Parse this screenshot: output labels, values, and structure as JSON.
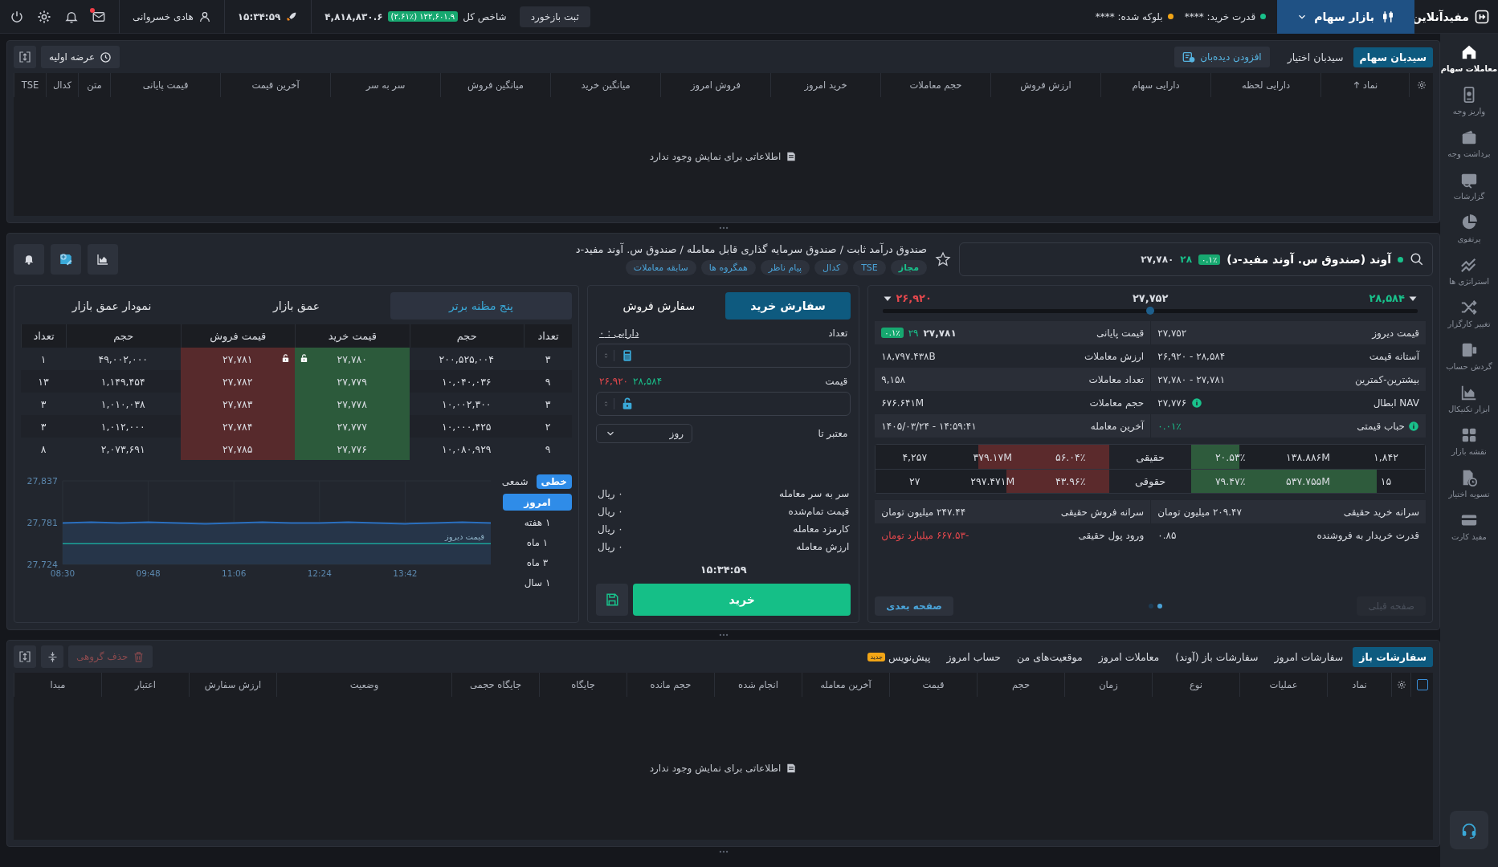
{
  "topbar": {
    "brand": "مفیدآنلاین",
    "market": "بازار سهام",
    "buying_power": "قدرت خرید: ****",
    "blocked": "بلوکه شده: ****",
    "feedback": "ثبت بازخورد",
    "index_label": "شاخص کل",
    "index_change": "(۲.۶۱٪) ۱۲۲,۶۰۱.۹",
    "index_value": "۴,۸۱۸,۸۳۰.۶",
    "time": "۱۵:۳۴:۵۹",
    "user": "هادی خسروانی",
    "mail_unread": true
  },
  "sidebar": {
    "items": [
      {
        "label": "معاملات سهام",
        "selected": true
      },
      {
        "label": "واریز وجه",
        "selected": false
      },
      {
        "label": "برداشت وجه",
        "selected": false
      },
      {
        "label": "گزارشات",
        "selected": false
      },
      {
        "label": "پرتفوی",
        "selected": false
      },
      {
        "label": "استراتژی ها",
        "selected": false
      },
      {
        "label": "تغییر کارگزار",
        "selected": false
      },
      {
        "label": "گردش حساب",
        "selected": false
      },
      {
        "label": "ابزار تکنیکال",
        "selected": false
      },
      {
        "label": "نقشه بازار",
        "selected": false
      },
      {
        "label": "تسویه اختیار",
        "selected": false
      },
      {
        "label": "مفید کارت",
        "selected": false
      }
    ]
  },
  "watchlist": {
    "tabs": [
      {
        "label": "سیدبان سهام",
        "selected": true
      },
      {
        "label": "سیدبان اختیار",
        "selected": false
      }
    ],
    "add_button": "افزودن دیده‌بان",
    "ipo_button": "عرضه اولیه",
    "columns": [
      {
        "label": "نماد",
        "sorted": true
      },
      {
        "label": "دارایی لحظه",
        "sorted": false
      },
      {
        "label": "دارایی سهام",
        "sorted": false
      },
      {
        "label": "ارزش فروش",
        "sorted": false
      },
      {
        "label": "حجم معاملات",
        "sorted": false
      },
      {
        "label": "خرید امروز",
        "sorted": false
      },
      {
        "label": "فروش امروز",
        "sorted": false
      },
      {
        "label": "میانگین خرید",
        "sorted": false
      },
      {
        "label": "میانگین فروش",
        "sorted": false
      },
      {
        "label": "سر به سر",
        "sorted": false
      },
      {
        "label": "آخرین قیمت",
        "sorted": false
      },
      {
        "label": "قیمت پایانی",
        "sorted": false
      },
      {
        "label": "متن",
        "sorted": false
      },
      {
        "label": "کدال",
        "sorted": false
      },
      {
        "label": "TSE",
        "sorted": false
      }
    ],
    "empty_message": "اطلاعاتی برای نمایش وجود ندارد"
  },
  "symbol": {
    "name": "آوند (صندوق س. آوند مفید-د)",
    "change_percent": "۰.۱٪",
    "change": "۲۸",
    "last_price": "۲۷,۷۸۰",
    "breadcrumb": "صندوق درآمد ثابت / صندوق سرمایه گذاری قابل معامله / صندوق س. آوند مفید-د",
    "tags": [
      {
        "label": "مجاز",
        "kind": "status"
      },
      {
        "label": "TSE",
        "kind": "link"
      },
      {
        "label": "کدال",
        "kind": "link"
      },
      {
        "label": "پیام ناظر",
        "kind": "link"
      },
      {
        "label": "همگروه ها",
        "kind": "link"
      },
      {
        "label": "سابقه معاملات",
        "kind": "link"
      }
    ]
  },
  "price_range": {
    "high": "۲۸,۵۸۴",
    "reference": "۲۷,۷۵۲",
    "low": "۲۶,۹۲۰",
    "level": 0.5
  },
  "stats": [
    {
      "kind": "plain",
      "label": "قیمت دیروز",
      "value": "۲۷,۷۵۲"
    },
    {
      "kind": "price",
      "label": "قیمت پایانی",
      "value": "۲۷,۷۸۱",
      "change": "۲۹",
      "change_percent": "۰.۱٪"
    },
    {
      "kind": "plain",
      "label": "آستانه قیمت",
      "value": "۲۶,۹۲۰ - ۲۸,۵۸۴"
    },
    {
      "kind": "plain",
      "label": "ارزش معاملات",
      "value": "۱۸,۷۹۷.۴۳۸B"
    },
    {
      "kind": "plain",
      "label": "بیشترین-کمترین",
      "value": "۲۷,۷۸۰ - ۲۷,۷۸۱"
    },
    {
      "kind": "plain",
      "label": "تعداد معاملات",
      "value": "۹,۱۵۸"
    },
    {
      "kind": "info_value",
      "label": "NAV ابطال",
      "value": "۲۷,۷۷۶"
    },
    {
      "kind": "plain",
      "label": "حجم معاملات",
      "value": "۶۷۶.۶۴۱M"
    },
    {
      "kind": "info_label",
      "label": "حباب قیمتی",
      "value": "۰.۰۱٪"
    },
    {
      "kind": "plain",
      "label": "آخرین معامله",
      "value": "۱۴۰۵/۰۳/۲۴ - ۱۴:۵۹:۴۱"
    }
  ],
  "traders": [
    {
      "label": "حقیقی",
      "buy": {
        "count": "۱,۸۴۲",
        "volume": "۱۳۸.۸۸۶M",
        "percent": "۲۰.۵۳٪",
        "level": 0.2053
      },
      "sell": {
        "count": "۴,۲۵۷",
        "volume": "۳۷۹.۱۷M",
        "percent": "۵۶.۰۴٪",
        "level": 0.5604
      }
    },
    {
      "label": "حقوقی",
      "buy": {
        "count": "۱۵",
        "volume": "۵۳۷.۷۵۵M",
        "percent": "۷۹.۴۷٪",
        "level": 0.7947
      },
      "sell": {
        "count": "۲۷",
        "volume": "۲۹۷.۴۷۱M",
        "percent": "۴۳.۹۶٪",
        "level": 0.4396
      }
    }
  ],
  "per_capita": [
    {
      "label": "سرانه خرید حقیقی",
      "value": "۲۰۹.۴۷ میلیون تومان",
      "negative": false
    },
    {
      "label": "سرانه فروش حقیقی",
      "value": "۲۴۷.۴۴ میلیون تومان",
      "negative": false
    },
    {
      "label": "قدرت خریدار به فروشنده",
      "value": "۰.۸۵",
      "negative": false
    },
    {
      "label": "ورود پول حقیقی",
      "value": "-۶۶۷.۵۳ میلیارد تومان",
      "negative": true
    }
  ],
  "pager": {
    "previous": {
      "label": "صفحه قبلی",
      "disabled": true
    },
    "next": {
      "label": "صفحه بعدی",
      "disabled": false
    },
    "pages": [
      {
        "selected": true
      },
      {
        "selected": false
      }
    ]
  },
  "order_form": {
    "tabs": [
      {
        "label": "سفارش خرید",
        "selected": true
      },
      {
        "label": "سفارش فروش",
        "selected": false
      }
    ],
    "quantity_label": "تعداد",
    "holding": "دارایی : ۰",
    "price_label": "قیمت",
    "price_high": "۲۸,۵۸۴",
    "price_low": "۲۶,۹۲۰",
    "validity_label": "معتبر تا",
    "validity": "روز",
    "summary": [
      {
        "label": "سر به سر معامله",
        "value": "۰ ریال"
      },
      {
        "label": "قیمت تمام‌شده",
        "value": "۰ ریال"
      },
      {
        "label": "کارمزد معامله",
        "value": "۰ ریال"
      },
      {
        "label": "ارزش معامله",
        "value": "۰ ریال"
      }
    ],
    "time": "۱۵:۳۴:۵۹",
    "submit": "خرید"
  },
  "order_book": {
    "tabs": [
      {
        "label": "پنج مظنه برتر",
        "selected": true
      },
      {
        "label": "عمق بازار",
        "selected": false
      },
      {
        "label": "نمودار عمق بازار",
        "selected": false
      }
    ],
    "columns": [
      "تعداد",
      "حجم",
      "قیمت خرید",
      "قیمت فروش",
      "حجم",
      "تعداد"
    ],
    "rows": [
      {
        "buy_count": "۳",
        "buy_volume": "۲۰۰,۵۲۵,۰۰۴",
        "buy_price": "۲۷,۷۸۰",
        "sell_price": "۲۷,۷۸۱",
        "sell_volume": "۴۹,۰۰۲,۰۰۰",
        "sell_count": "۱",
        "locked": true
      },
      {
        "buy_count": "۹",
        "buy_volume": "۱۰,۰۴۰,۰۳۶",
        "buy_price": "۲۷,۷۷۹",
        "sell_price": "۲۷,۷۸۲",
        "sell_volume": "۱,۱۴۹,۴۵۴",
        "sell_count": "۱۳",
        "locked": false
      },
      {
        "buy_count": "۳",
        "buy_volume": "۱۰,۰۰۲,۳۰۰",
        "buy_price": "۲۷,۷۷۸",
        "sell_price": "۲۷,۷۸۳",
        "sell_volume": "۱,۰۱۰,۰۳۸",
        "sell_count": "۳",
        "locked": false
      },
      {
        "buy_count": "۲",
        "buy_volume": "۱۰,۰۰۰,۴۲۵",
        "buy_price": "۲۷,۷۷۷",
        "sell_price": "۲۷,۷۸۴",
        "sell_volume": "۱,۰۱۲,۰۰۰",
        "sell_count": "۳",
        "locked": false
      },
      {
        "buy_count": "۹",
        "buy_volume": "۱۰,۰۸۰,۹۲۹",
        "buy_price": "۲۷,۷۷۶",
        "sell_price": "۲۷,۷۸۵",
        "sell_volume": "۲,۰۷۳,۶۹۱",
        "sell_count": "۸",
        "locked": false
      }
    ]
  },
  "price_chart": {
    "chart_types": [
      {
        "label": "خطی",
        "selected": true
      },
      {
        "label": "شمعی",
        "selected": false
      }
    ],
    "periods": [
      {
        "label": "امروز",
        "selected": true
      },
      {
        "label": "۱ هفته",
        "selected": false
      },
      {
        "label": "۱ ماه",
        "selected": false
      },
      {
        "label": "۳ ماه",
        "selected": false
      },
      {
        "label": "۱ سال",
        "selected": false
      }
    ],
    "chart_data": {
      "type": "area",
      "categories": [
        "08:30",
        null,
        null,
        "09:48",
        null,
        null,
        "11:06",
        null,
        null,
        "12:24",
        null,
        null,
        "13:42",
        null,
        null,
        null
      ],
      "series": [
        {
          "color": "#2a6fbf",
          "values": [
            27780,
            27781,
            27780,
            27781,
            27780,
            27779,
            27780,
            27781,
            27780,
            27780,
            27781,
            27780,
            27779,
            27780,
            27781,
            27780
          ]
        },
        {
          "name": "قیمت دیروز",
          "type": "line",
          "color": "#1aa39a",
          "values": [
            27752,
            27752,
            27752,
            27752,
            27752,
            27752,
            27752,
            27752,
            27752,
            27752,
            27752,
            27752,
            27752,
            27752,
            27752,
            27752
          ]
        }
      ],
      "ylim": [
        27724,
        27837
      ],
      "yticks": [
        {
          "value": 27724,
          "label": "27,724"
        },
        {
          "value": 27781,
          "label": "27,781"
        },
        {
          "value": 27837,
          "label": "27,837"
        }
      ],
      "grid": true
    }
  },
  "orders": {
    "tabs": [
      {
        "label": "سفارشات باز",
        "selected": true
      },
      {
        "label": "سفارشات امروز",
        "selected": false
      },
      {
        "label": "سفارشات باز (آوند)",
        "selected": false
      },
      {
        "label": "معاملات امروز",
        "selected": false
      },
      {
        "label": "موقعیت‌های من",
        "selected": false
      },
      {
        "label": "حساب امروز",
        "selected": false
      },
      {
        "label": "پیش‌نویس",
        "selected": false,
        "badge": "جدید"
      }
    ],
    "delete_button": {
      "label": "حذف گروهی",
      "disabled": true
    },
    "select_all": {
      "checked": false
    },
    "columns": [
      "نماد",
      "عملیات",
      "نوع",
      "زمان",
      "حجم",
      "قیمت",
      "آخرین معامله",
      "انجام شده",
      "حجم مانده",
      "جایگاه",
      "جایگاه حجمی",
      "وضعیت",
      "ارزش سفارش",
      "اعتبار",
      "مبدا"
    ],
    "empty_message": "اطلاعاتی برای نمایش وجود ندارد"
  }
}
